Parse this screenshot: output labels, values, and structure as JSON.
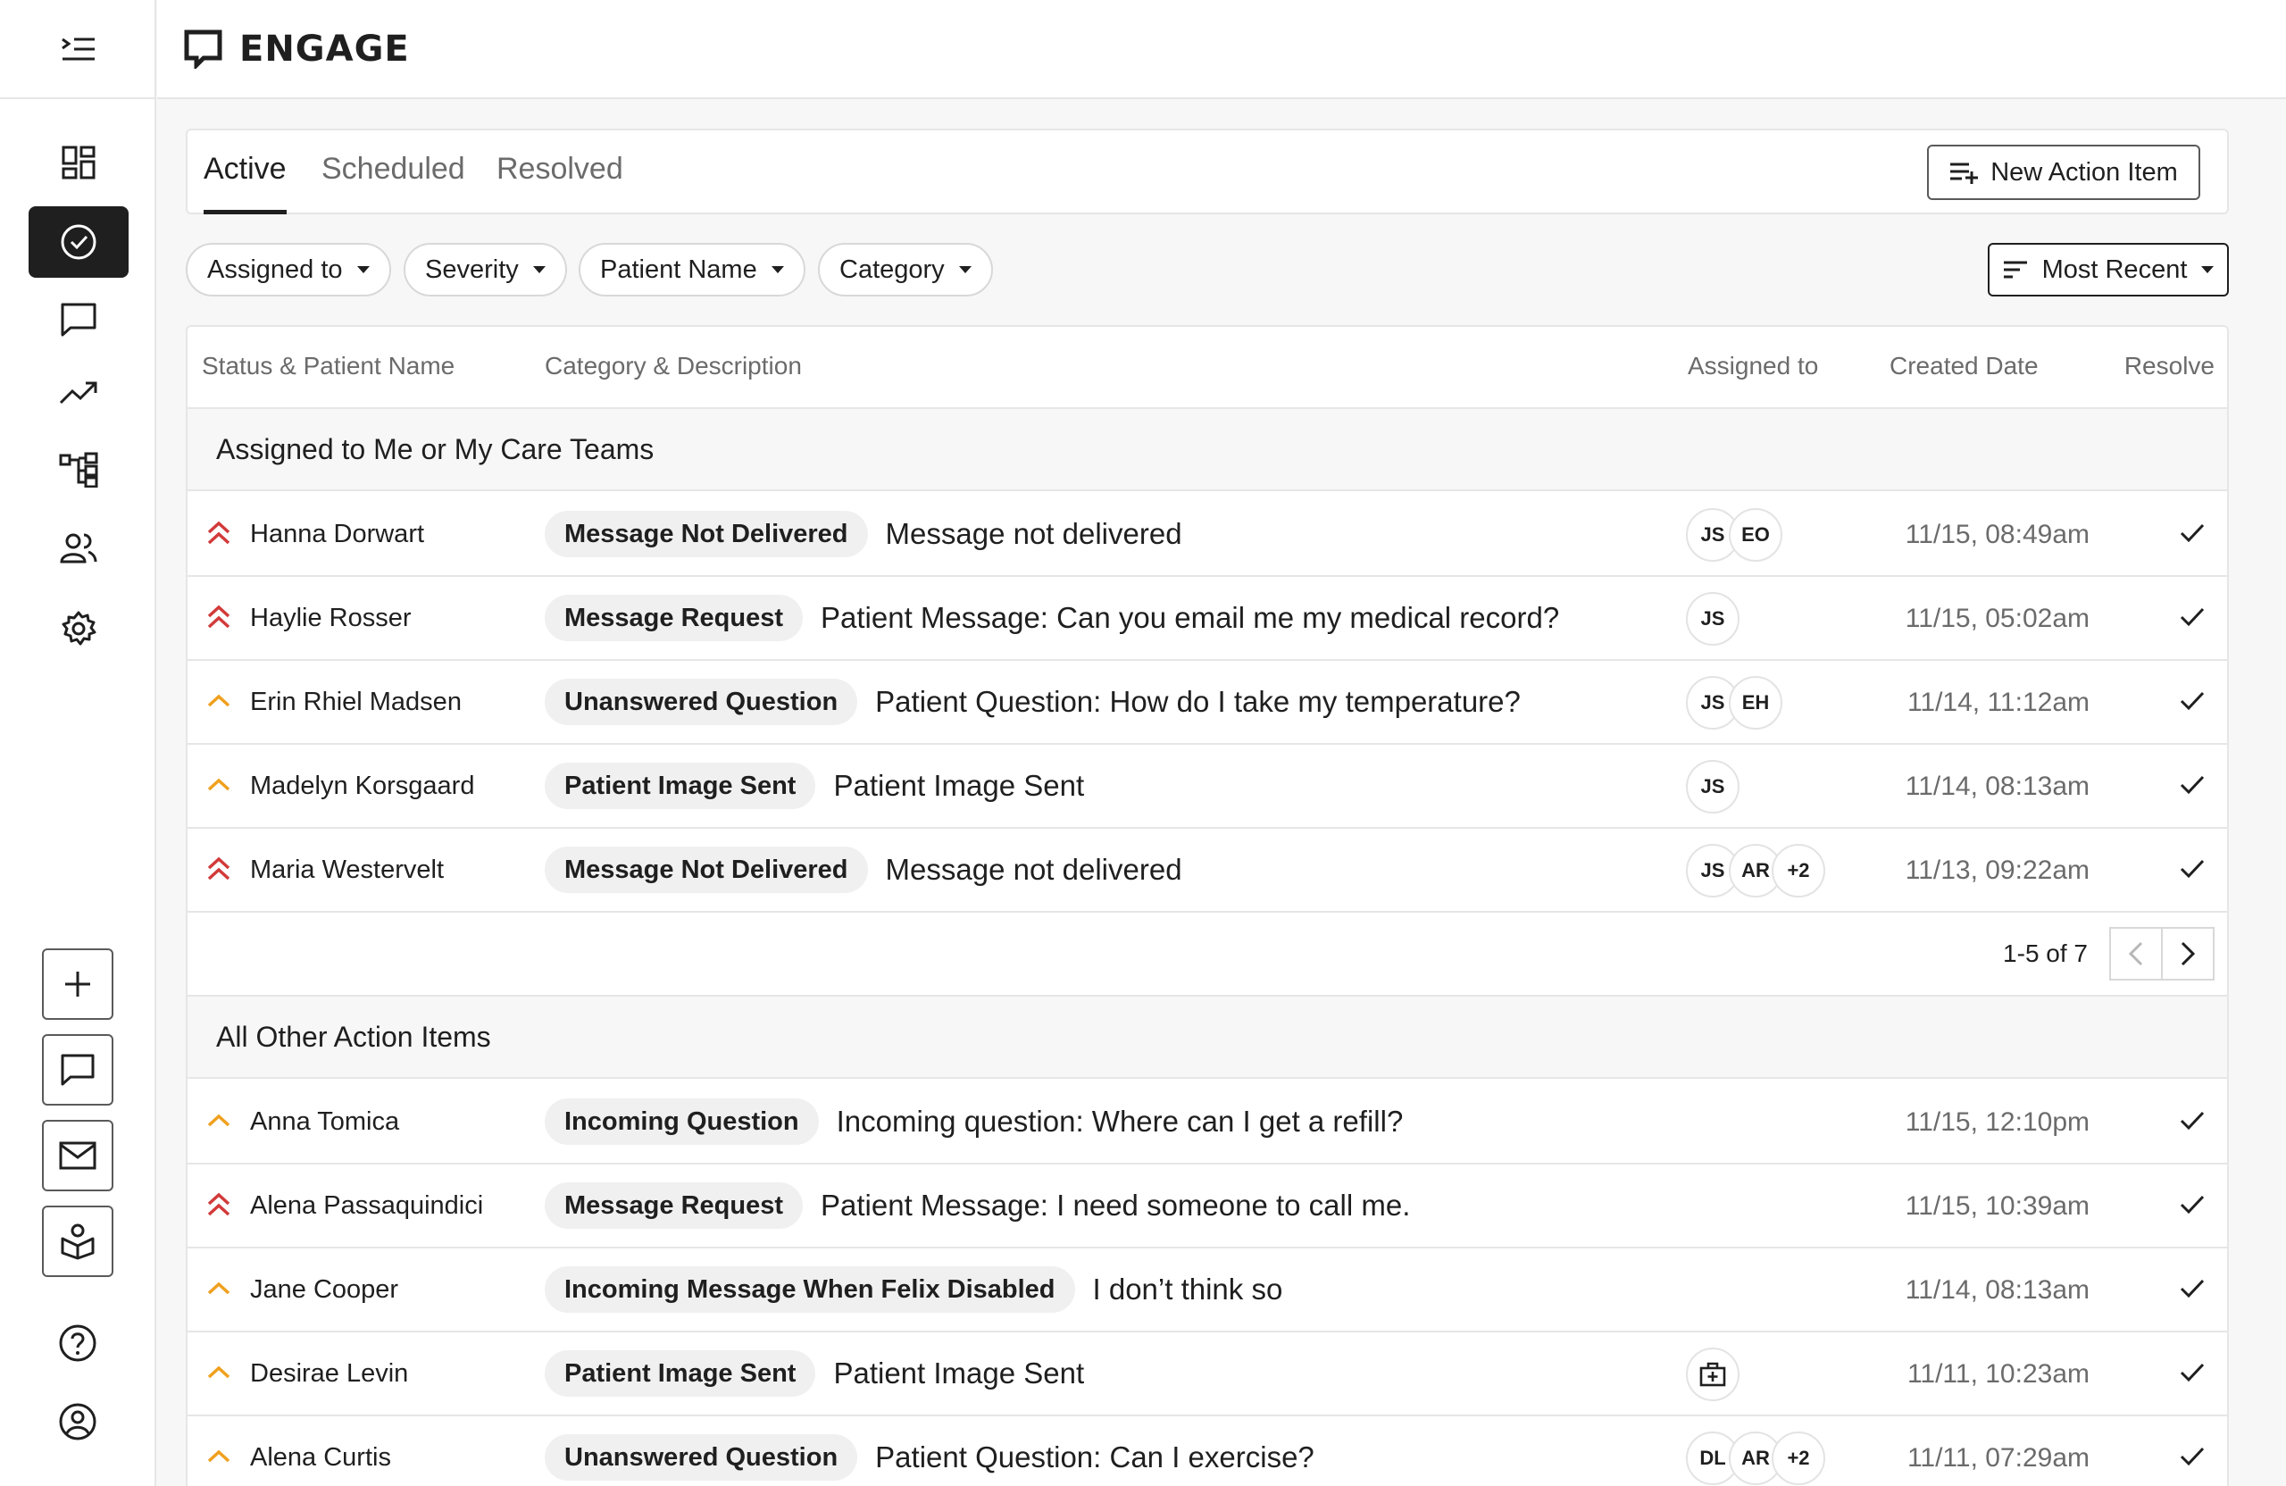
{
  "app": {
    "brand": "ENGAGE"
  },
  "sidebar": {
    "nav": [
      {
        "icon": "dashboard-icon"
      },
      {
        "icon": "check-circle-icon",
        "active": true
      },
      {
        "icon": "chat-icon"
      },
      {
        "icon": "trending-icon"
      },
      {
        "icon": "hierarchy-icon"
      },
      {
        "icon": "users-icon"
      },
      {
        "icon": "gear-icon"
      }
    ],
    "actions": [
      "plus-icon",
      "message-icon",
      "mail-icon",
      "patient-icon"
    ],
    "bottom": [
      "help-icon",
      "profile-icon"
    ]
  },
  "tabs": [
    {
      "label": "Active",
      "active": true
    },
    {
      "label": "Scheduled"
    },
    {
      "label": "Resolved"
    }
  ],
  "new_button_label": "New Action Item",
  "filters": [
    "Assigned to",
    "Severity",
    "Patient Name",
    "Category"
  ],
  "sort_label": "Most Recent",
  "columns": {
    "status": "Status & Patient Name",
    "category": "Category & Description",
    "assigned": "Assigned to",
    "created": "Created Date",
    "resolve": "Resolve"
  },
  "sections": [
    {
      "title": "Assigned to Me or My Care Teams",
      "rows": [
        {
          "severity": "high",
          "name": "Hanna Dorwart",
          "category": "Message Not Delivered",
          "description": "Message not delivered",
          "assigned": [
            "JS",
            "EO"
          ],
          "date": "11/15, 08:49am"
        },
        {
          "severity": "high",
          "name": "Haylie Rosser",
          "category": "Message Request",
          "description": "Patient Message: Can you email me my medical record?",
          "assigned": [
            "JS"
          ],
          "date": "11/15, 05:02am"
        },
        {
          "severity": "medium",
          "name": "Erin Rhiel Madsen",
          "category": "Unanswered Question",
          "description": "Patient Question: How do I take my temperature?",
          "assigned": [
            "JS",
            "EH"
          ],
          "date": "11/14, 11:12am"
        },
        {
          "severity": "medium",
          "name": "Madelyn Korsgaard",
          "category": "Patient Image Sent",
          "description": "Patient Image Sent",
          "assigned": [
            "JS"
          ],
          "date": "11/14, 08:13am"
        },
        {
          "severity": "high",
          "name": "Maria Westervelt",
          "category": "Message Not Delivered",
          "description": "Message not delivered",
          "assigned": [
            "JS",
            "AR",
            "+2"
          ],
          "date": "11/13, 09:22am"
        }
      ],
      "pagination": "1-5 of 7"
    },
    {
      "title": "All Other Action Items",
      "rows": [
        {
          "severity": "medium",
          "name": "Anna Tomica",
          "category": "Incoming Question",
          "description": "Incoming question: Where can I get a refill?",
          "assigned": [],
          "date": "11/15, 12:10pm"
        },
        {
          "severity": "high",
          "name": "Alena Passaquindici",
          "category": "Message Request",
          "description": "Patient Message: I need someone to call me.",
          "assigned": [],
          "date": "11/15, 10:39am"
        },
        {
          "severity": "medium",
          "name": "Jane Cooper",
          "category": "Incoming Message When Felix Disabled",
          "description": "I don’t think so",
          "assigned": [],
          "date": "11/14, 08:13am"
        },
        {
          "severity": "medium",
          "name": "Desirae Levin",
          "category": "Patient Image Sent",
          "description": "Patient Image Sent",
          "assigned_icon": "medical-kit-icon",
          "assigned": [],
          "date": "11/11, 10:23am"
        },
        {
          "severity": "medium",
          "name": "Alena Curtis",
          "category": "Unanswered Question",
          "description": "Patient Question: Can I exercise?",
          "assigned": [
            "DL",
            "AR",
            "+2"
          ],
          "date": "11/11, 07:29am"
        }
      ]
    }
  ],
  "colors": {
    "high": "#d23a3a",
    "medium": "#f0a01e",
    "active_nav": "#1f1f1f"
  }
}
